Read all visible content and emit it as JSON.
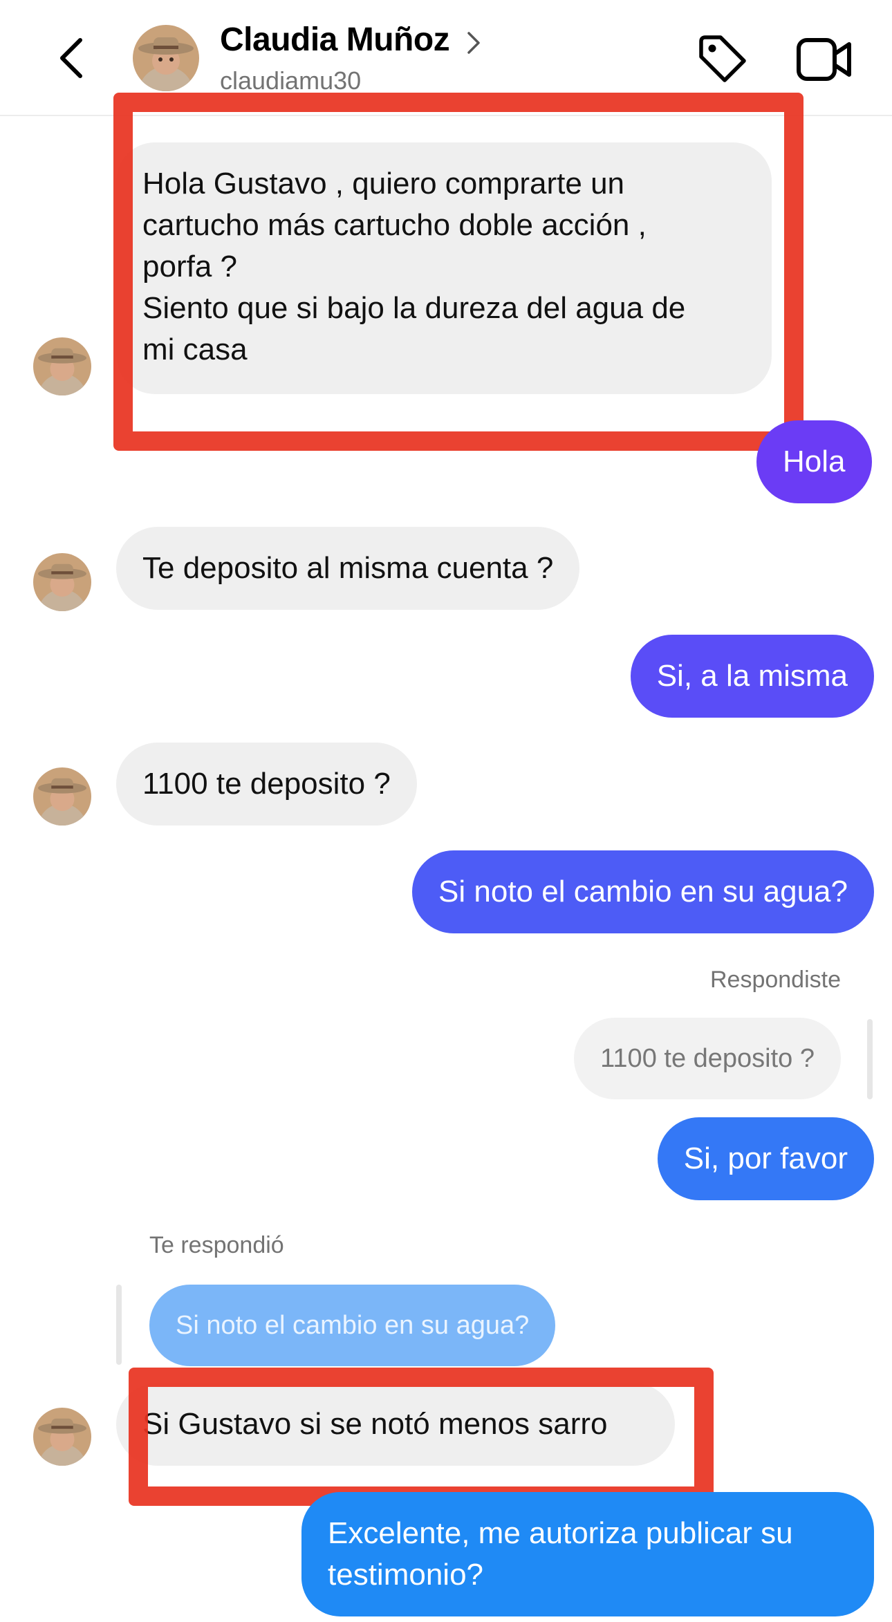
{
  "header": {
    "name": "Claudia Muñoz",
    "username": "claudiamu30"
  },
  "colors": {
    "incoming_bubble": "#efefef",
    "outgoing_gradient": [
      "#6b3cf5",
      "#5a4df7",
      "#4d5cf6",
      "#3f6df5",
      "#3478f6",
      "#1f8af5"
    ],
    "quoted_reply_bg": "#7bb6f8",
    "annotation_red": "#e8321f"
  },
  "messages": [
    {
      "id": "m1",
      "direction": "in",
      "lines": [
        "Hola Gustavo , quiero comprarte un",
        "cartucho más cartucho doble acción ,",
        "porfa ?",
        "Siento que si bajo la dureza del agua de",
        "mi casa"
      ]
    },
    {
      "id": "m2",
      "direction": "out",
      "text": "Hola"
    },
    {
      "id": "m3",
      "direction": "in",
      "text": "Te deposito al misma cuenta ?"
    },
    {
      "id": "m4",
      "direction": "out",
      "text": "Si, a la misma"
    },
    {
      "id": "m5",
      "direction": "in",
      "text": "1100 te deposito ?"
    },
    {
      "id": "m6",
      "direction": "out",
      "text": "Si noto el cambio en su agua?"
    },
    {
      "id": "m7",
      "direction": "out",
      "reply_label": "Respondiste",
      "quoted_text": "1100 te deposito ?",
      "text": "Si, por favor"
    },
    {
      "id": "m8",
      "direction": "in",
      "reply_label": "Te respondió",
      "quoted_text": "Si noto el cambio en su agua?",
      "text": "Si Gustavo si se notó menos sarro"
    },
    {
      "id": "m9",
      "direction": "out",
      "lines": [
        "Excelente, me autoriza publicar su",
        "testimonio?"
      ]
    }
  ]
}
